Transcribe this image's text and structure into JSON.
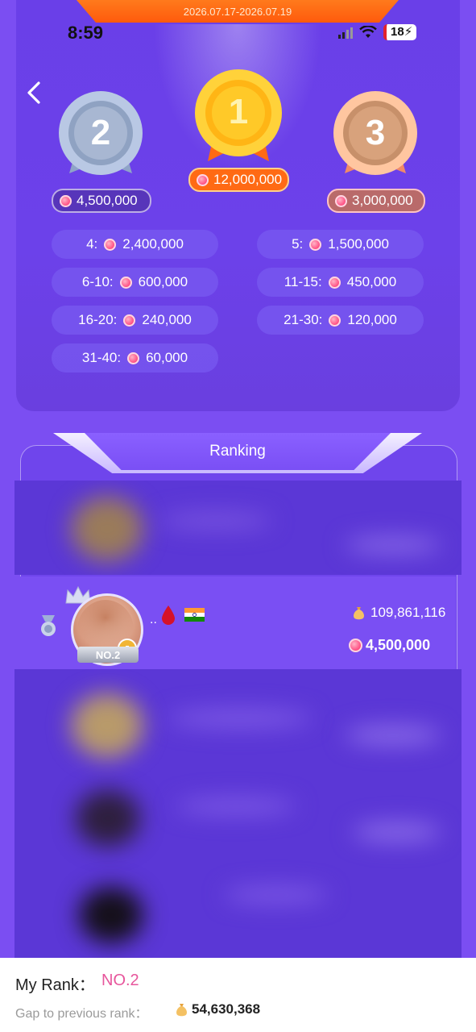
{
  "header": {
    "date_range": "2026.07.17-2026.07.19"
  },
  "status_bar": {
    "time": "8:59",
    "battery": "18"
  },
  "podium": [
    {
      "rank": "2",
      "prize": "4,500,000"
    },
    {
      "rank": "1",
      "prize": "12,000,000"
    },
    {
      "rank": "3",
      "prize": "3,000,000"
    }
  ],
  "tiers": [
    {
      "range": "4:",
      "prize": "2,400,000"
    },
    {
      "range": "5:",
      "prize": "1,500,000"
    },
    {
      "range": "6-10:",
      "prize": "600,000"
    },
    {
      "range": "11-15:",
      "prize": "450,000"
    },
    {
      "range": "16-20:",
      "prize": "240,000"
    },
    {
      "range": "21-30:",
      "prize": "120,000"
    },
    {
      "range": "31-40:",
      "prize": "60,000"
    }
  ],
  "ranking": {
    "title": "Ranking",
    "my_row": {
      "name": "..",
      "badge": "NO.2",
      "score": "109,861,116",
      "reward": "4,500,000"
    }
  },
  "footer": {
    "my_rank_label": "My Rank：",
    "my_rank_value": "NO.2",
    "gap_label": "Gap to previous rank：",
    "gap_value": "54,630,368"
  },
  "colors": {
    "accent_pink": "#e7569c",
    "panel": "#6c41ea",
    "orange": "#ff6a14"
  }
}
